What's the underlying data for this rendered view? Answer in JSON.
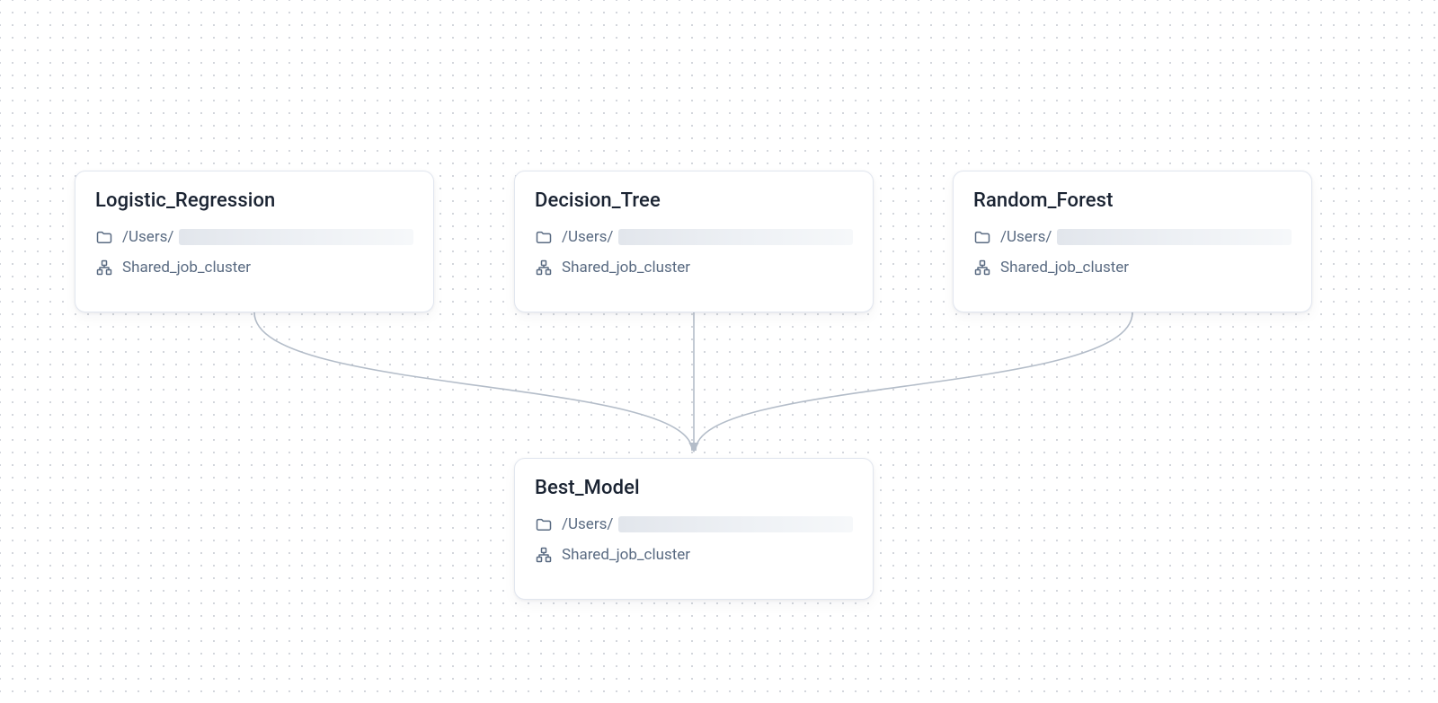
{
  "colors": {
    "dot": "#c4c9d1",
    "card_border": "#e1e6ef",
    "title": "#1a2332",
    "meta": "#5a6b82",
    "connector": "#b4bdc9"
  },
  "diagram": {
    "workflow": "training-and-selection",
    "edges": [
      {
        "from": "logistic_regression",
        "to": "best_model"
      },
      {
        "from": "decision_tree",
        "to": "best_model"
      },
      {
        "from": "random_forest",
        "to": "best_model"
      }
    ]
  },
  "nodes": {
    "logistic_regression": {
      "title": "Logistic_Regression",
      "path_prefix": "/Users/",
      "cluster": "Shared_job_cluster"
    },
    "decision_tree": {
      "title": "Decision_Tree",
      "path_prefix": "/Users/",
      "cluster": "Shared_job_cluster"
    },
    "random_forest": {
      "title": "Random_Forest",
      "path_prefix": "/Users/",
      "cluster": "Shared_job_cluster"
    },
    "best_model": {
      "title": "Best_Model",
      "path_prefix": "/Users/",
      "cluster": "Shared_job_cluster"
    }
  }
}
